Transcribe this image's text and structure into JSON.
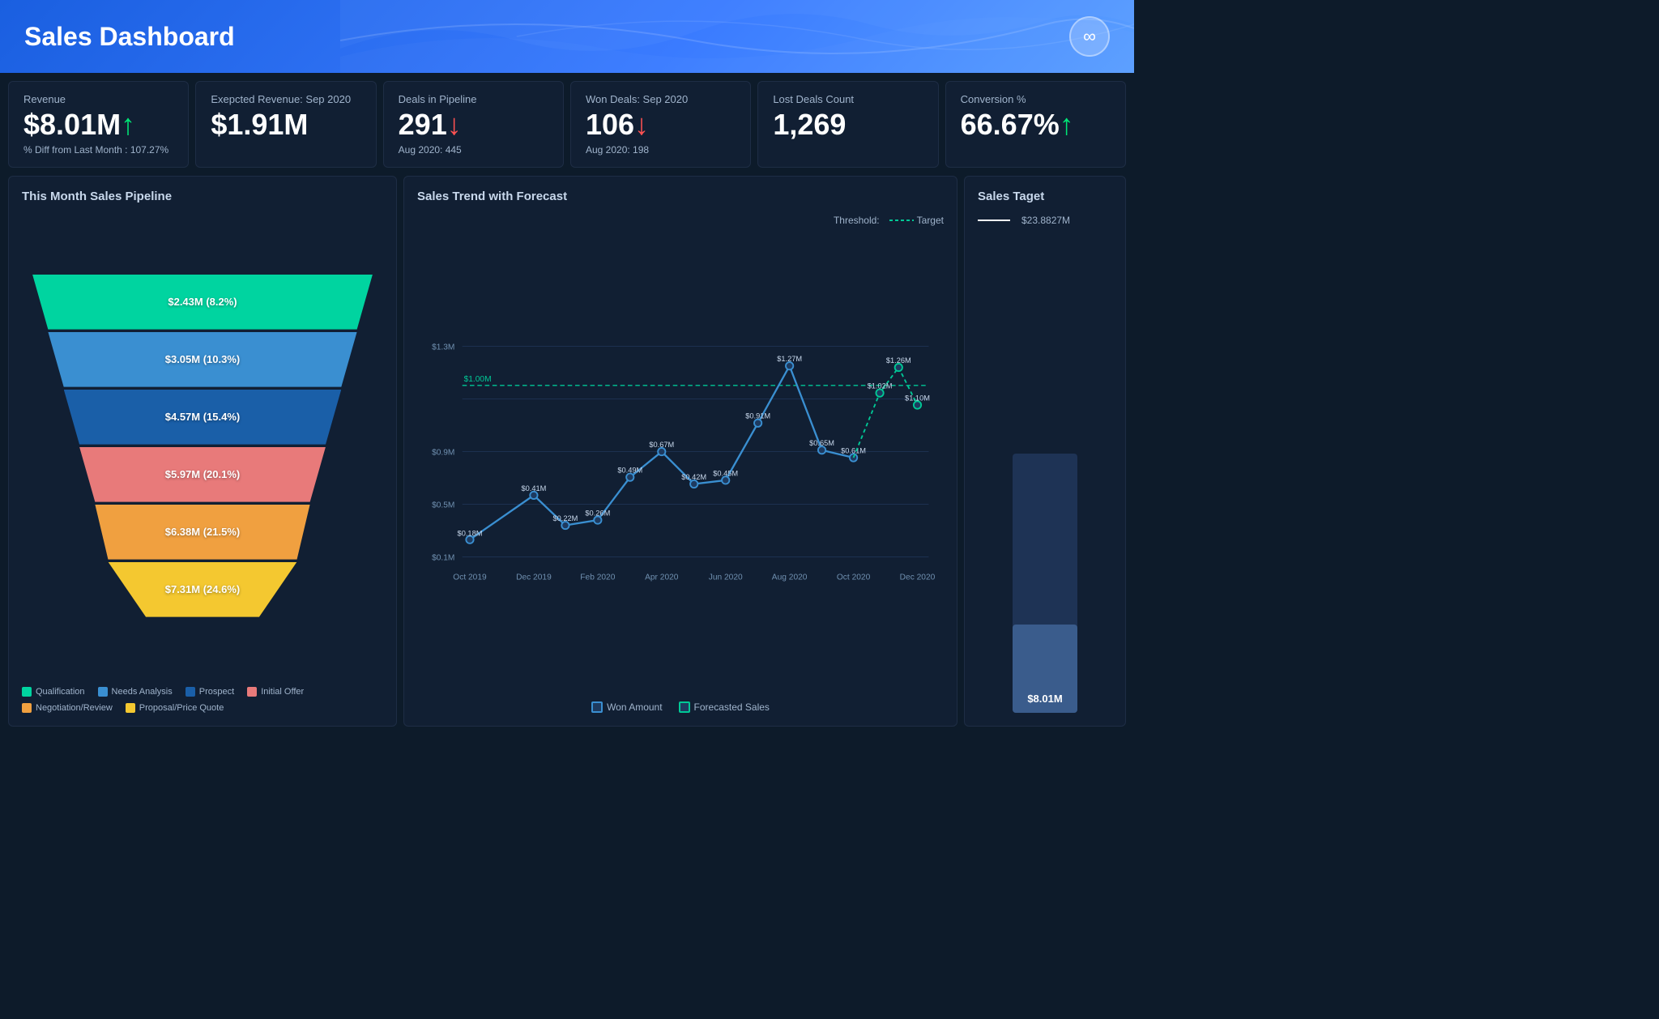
{
  "header": {
    "title": "Sales Dashboard",
    "logo_icon": "∞"
  },
  "kpis": [
    {
      "label": "Revenue",
      "value": "$8.01M",
      "arrow": "↑",
      "arrow_type": "up",
      "sub": "% Diff from Last Month : 107.27%"
    },
    {
      "label": "Exepcted Revenue: Sep 2020",
      "value": "$1.91M",
      "arrow": "",
      "arrow_type": "",
      "sub": ""
    },
    {
      "label": "Deals in Pipeline",
      "value": "291",
      "arrow": "↓",
      "arrow_type": "down",
      "sub": "Aug 2020: 445"
    },
    {
      "label": "Won Deals: Sep 2020",
      "value": "106",
      "arrow": "↓",
      "arrow_type": "down",
      "sub": "Aug 2020: 198"
    },
    {
      "label": "Lost Deals Count",
      "value": "1,269",
      "arrow": "",
      "arrow_type": "",
      "sub": ""
    },
    {
      "label": "Conversion %",
      "value": "66.67%",
      "arrow": "↑",
      "arrow_type": "up",
      "sub": ""
    }
  ],
  "funnel": {
    "title": "This Month Sales Pipeline",
    "rows": [
      {
        "label": "$2.43M (8.2%)",
        "color": "#00d4a0",
        "width_pct": 90
      },
      {
        "label": "$3.05M (10.3%)",
        "color": "#3a8fd1",
        "width_pct": 78
      },
      {
        "label": "$4.57M (15.4%)",
        "color": "#1a5fa8",
        "width_pct": 66
      },
      {
        "label": "$5.97M (20.1%)",
        "color": "#e87a7a",
        "width_pct": 54
      },
      {
        "label": "$6.38M (21.5%)",
        "color": "#f0a040",
        "width_pct": 42
      },
      {
        "label": "$7.31M (24.6%)",
        "color": "#f4c830",
        "width_pct": 32
      }
    ],
    "legend": [
      {
        "label": "Qualification",
        "color": "#00d4a0"
      },
      {
        "label": "Needs Analysis",
        "color": "#3a8fd1"
      },
      {
        "label": "Prospect",
        "color": "#1a5fa8"
      },
      {
        "label": "Initial Offer",
        "color": "#e87a7a"
      },
      {
        "label": "Negotiation/Review",
        "color": "#f0a040"
      },
      {
        "label": "Proposal/Price Quote",
        "color": "#f4c830"
      }
    ]
  },
  "chart": {
    "title": "Sales Trend with Forecast",
    "threshold_label": "Threshold:",
    "target_label": "Target",
    "threshold_value": "$1.00M",
    "won_amount_label": "Won Amount",
    "forecasted_label": "Forecasted Sales",
    "x_labels": [
      "Oct 2019",
      "Dec 2019",
      "Feb 2020",
      "Apr 2020",
      "Jun 2020",
      "Aug 2020",
      "Oct 2020",
      "Dec 2020"
    ],
    "y_labels": [
      "$1.3M",
      "$0.9M",
      "$0.5M",
      "$0.1M"
    ],
    "data_points": [
      {
        "x": "Oct 2019",
        "v": 0.18,
        "label": "$0.18M"
      },
      {
        "x": "Dec 2019",
        "v": 0.41,
        "label": "$0.41M"
      },
      {
        "x": "Jan 2020",
        "v": 0.22,
        "label": "$0.22M"
      },
      {
        "x": "Feb 2020",
        "v": 0.26,
        "label": "$0.26M"
      },
      {
        "x": "Mar 2020",
        "v": 0.49,
        "label": "$0.49M"
      },
      {
        "x": "Apr 2020",
        "v": 0.67,
        "label": "$0.67M"
      },
      {
        "x": "May 2020",
        "v": 0.42,
        "label": "$0.42M"
      },
      {
        "x": "Jun 2020",
        "v": 0.45,
        "label": "$0.45M"
      },
      {
        "x": "Jul 2020",
        "v": 0.91,
        "label": "$0.91M"
      },
      {
        "x": "Aug 2020",
        "v": 1.27,
        "label": "$1.27M"
      },
      {
        "x": "Sep 2020",
        "v": 0.65,
        "label": "$0.65M"
      },
      {
        "x": "Oct 2020",
        "v": 0.61,
        "label": "$0.61M"
      }
    ],
    "forecast_points": [
      {
        "x": "Oct 2020",
        "v": 0.61
      },
      {
        "x": "Nov 2020",
        "v": 1.02,
        "label": "$1.02M"
      },
      {
        "x": "Nov2 2020",
        "v": 1.26,
        "label": "$1.26M"
      },
      {
        "x": "Dec 2020",
        "v": 1.1,
        "label": "$1.10M"
      }
    ]
  },
  "target": {
    "title": "Sales Taget",
    "target_value": "$23.8827M",
    "current_value": "$8.01M",
    "fill_pct": 34
  }
}
